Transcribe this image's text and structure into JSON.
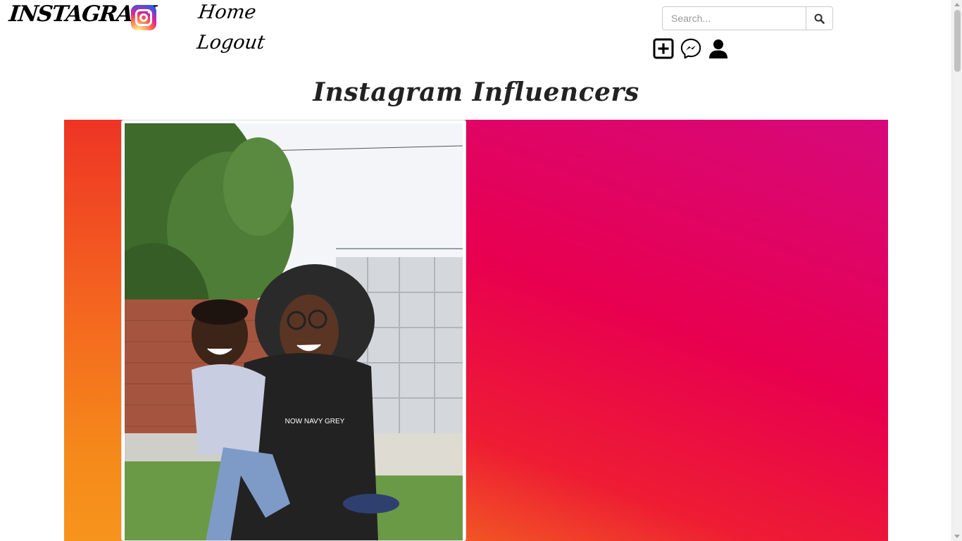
{
  "navbar": {
    "brand": "INSTAGRAM",
    "logo_icon": "instagram-logo-icon",
    "links": [
      {
        "label": "Home"
      },
      {
        "label": "Logout"
      }
    ],
    "search": {
      "placeholder": "Search...",
      "value": "",
      "button_icon": "search-icon"
    },
    "actions": [
      {
        "icon": "add-post-icon"
      },
      {
        "icon": "messenger-icon"
      },
      {
        "icon": "user-profile-icon"
      }
    ]
  },
  "main": {
    "title": "Instagram Influencers",
    "hero": {
      "colors": {
        "magenta": "#d6097b",
        "red": "#e8004f",
        "orange": "#f7941d"
      },
      "featured_photo": {
        "shirt_text": "NOW NAVY GREY"
      }
    }
  }
}
